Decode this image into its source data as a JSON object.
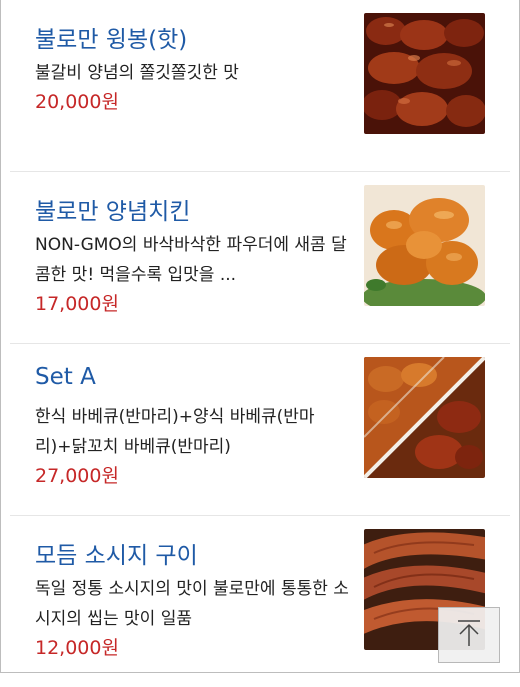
{
  "menu": {
    "items": [
      {
        "name": "불로만 윙봉(핫)",
        "desc": "불갈비 양념의 쫄깃쫄깃한 맛",
        "price": "20,000원",
        "image": "spicy-wings-photo"
      },
      {
        "name": "불로만 양념치킨",
        "desc": "NON-GMO의 바삭바삭한 파우더에 새콤 달콤한 맛! 먹을수록 입맛을 ...",
        "price": "17,000원",
        "image": "fried-chicken-photo"
      },
      {
        "name": "Set A",
        "desc": "한식 바베큐(반마리)+양식 바베큐(반마리)+닭꼬치 바베큐(반마리)",
        "price": "27,000원",
        "image": "set-a-photo"
      },
      {
        "name": "모듬 소시지 구이",
        "desc": "독일 정통 소시지의 맛이 불로만에 통통한 소시지의 씹는 맛이 일품",
        "price": "12,000원",
        "image": "grilled-sausage-photo"
      }
    ]
  },
  "scroll_top": {
    "icon": "arrow-up-icon"
  },
  "colors": {
    "name": "#1f5aa6",
    "price": "#c62828",
    "text": "#222222"
  }
}
